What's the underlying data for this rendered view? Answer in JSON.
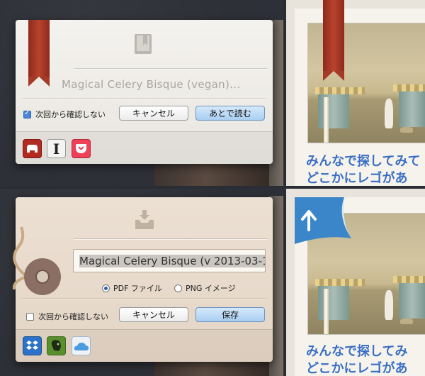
{
  "top_dialog": {
    "title": "Magical Celery Bisque (vegan)...",
    "checkbox_label": "次回から確認しない",
    "checkbox_checked": true,
    "cancel_label": "キャンセル",
    "confirm_label": "あとで読む",
    "services": [
      "readability-icon",
      "instapaper-icon",
      "pocket-icon"
    ]
  },
  "bottom_dialog": {
    "title_field_value": "Magical Celery Bisque (v 2013-03-1",
    "radio_pdf_label": "PDF ファイル",
    "radio_png_label": "PNG イメージ",
    "selected_format": "PDF ファイル",
    "checkbox_label": "次回から確認しない",
    "checkbox_checked": false,
    "cancel_label": "キャンセル",
    "confirm_label": "保存",
    "services": [
      "dropbox-icon",
      "evernote-icon",
      "icloud-icon"
    ]
  },
  "article_top": {
    "line1": "みんなで探してみて",
    "line2": "どこかにレゴがあ"
  },
  "article_bottom": {
    "line1": "みんなで探してみ",
    "line2": "どこかにレゴがあ"
  },
  "colors": {
    "accent_blue": "#3a6fc4",
    "ribbon_red": "#b8432d",
    "confirm_button": "#a9cef2"
  }
}
